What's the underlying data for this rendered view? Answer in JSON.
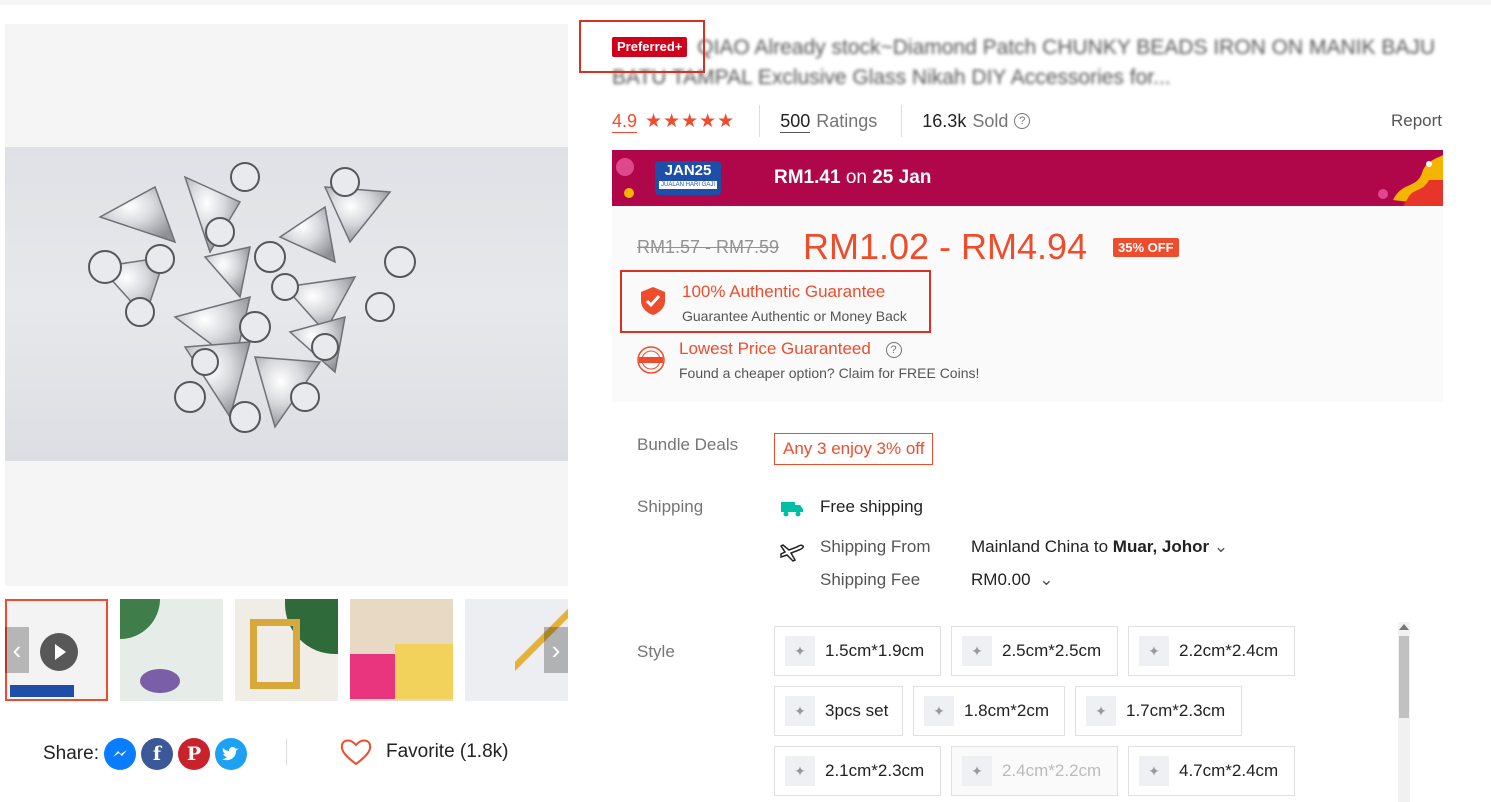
{
  "title": {
    "badge": "Preferred+",
    "text": "QIAO Already stock~Diamond Patch CHUNKY BEADS IRON ON MANIK BAJU BATU TAMPAL Exclusive Glass Nikah DIY Accessories for..."
  },
  "rating": {
    "score": "4.9",
    "stars": "★★★★★",
    "ratings_count": "500",
    "ratings_label": "Ratings",
    "sold_count": "16.3k",
    "sold_label": "Sold",
    "report": "Report"
  },
  "promo": {
    "badge_main": "JAN25",
    "badge_sub": "JUALAN HARI GAJI",
    "price": "RM1.41",
    "on": "on",
    "date": "25 Jan",
    "color": "#b0074b"
  },
  "price": {
    "original": "RM1.57 - RM7.59",
    "current": "RM1.02 - RM4.94",
    "discount": "35% OFF"
  },
  "guarantees": [
    {
      "title": "100% Authentic Guarantee",
      "subtitle": "Guarantee Authentic or Money Back"
    },
    {
      "title": "Lowest Price Guaranteed",
      "subtitle": "Found a cheaper option? Claim for FREE Coins!"
    }
  ],
  "bundle": {
    "label": "Bundle Deals",
    "value": "Any 3 enjoy 3% off"
  },
  "shipping": {
    "label": "Shipping",
    "free": "Free shipping",
    "from_label": "Shipping From",
    "from_value": "Mainland China",
    "to_word": "to",
    "destination": "Muar, Johor",
    "fee_label": "Shipping Fee",
    "fee_value": "RM0.00"
  },
  "style": {
    "label": "Style",
    "options": [
      {
        "label": "1.5cm*1.9cm",
        "disabled": false
      },
      {
        "label": "2.5cm*2.5cm",
        "disabled": false
      },
      {
        "label": "2.2cm*2.4cm",
        "disabled": false
      },
      {
        "label": "3pcs set",
        "disabled": false
      },
      {
        "label": "1.8cm*2cm",
        "disabled": false
      },
      {
        "label": "1.7cm*2.3cm",
        "disabled": false
      },
      {
        "label": "2.1cm*2.3cm",
        "disabled": false
      },
      {
        "label": "2.4cm*2.2cm",
        "disabled": true
      },
      {
        "label": "4.7cm*2.4cm",
        "disabled": false
      }
    ]
  },
  "share": {
    "label": "Share:"
  },
  "favorite": {
    "label": "Favorite (1.8k)"
  },
  "colors": {
    "accent": "#ee4d2d",
    "preferred": "#d0011b",
    "highlight_box": "#d93025"
  }
}
